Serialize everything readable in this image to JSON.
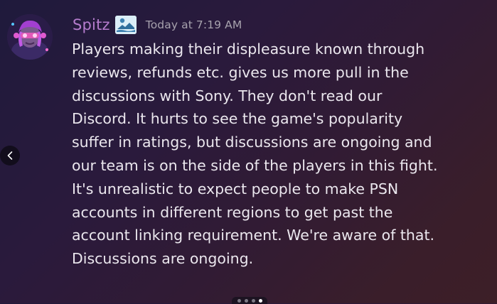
{
  "message": {
    "author": {
      "name": "Spitz",
      "avatar_icon": "avatar-image",
      "role_badge_icon": "landscape-badge-icon",
      "name_color": "#b57ccd"
    },
    "timestamp": "Today at 7:19 AM",
    "content_lines": [
      "Players making their displeasure known through",
      "reviews, refunds etc. gives us more pull in the",
      "discussions with Sony. They don't read our",
      "Discord. It hurts to see the game's popularity",
      "suffer in ratings, but discussions are ongoing and",
      "our team is on the side of the players in this fight.",
      "It's unrealistic to expect people to make PSN",
      "accounts in different regions to get past the",
      "account linking requirement. We're aware of that.",
      "Discussions are ongoing."
    ]
  },
  "carousel": {
    "prev_icon": "chevron-left-icon",
    "dots": [
      {
        "active": false
      },
      {
        "active": false
      },
      {
        "active": false
      },
      {
        "active": true
      }
    ]
  }
}
